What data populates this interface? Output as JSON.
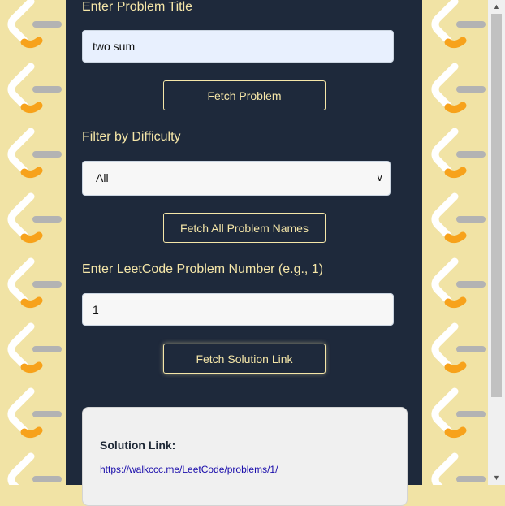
{
  "form": {
    "title_label": "Enter Problem Title",
    "title_value": "two sum",
    "fetch_problem_label": "Fetch Problem",
    "difficulty_label": "Filter by Difficulty",
    "difficulty_selected": "All",
    "fetch_all_label": "Fetch All Problem Names",
    "number_label": "Enter LeetCode Problem Number (e.g., 1)",
    "number_value": "1",
    "fetch_solution_label": "Fetch Solution Link"
  },
  "result": {
    "title": "Solution Link:",
    "link": "https://walkccc.me/LeetCode/problems/1/"
  },
  "theme": {
    "panel_bg": "#1e293b",
    "accent": "#f5e6a8",
    "pattern_bg": "#f1e3a5",
    "logo_orange": "#f7a21b",
    "logo_gray": "#b3b3b3"
  }
}
